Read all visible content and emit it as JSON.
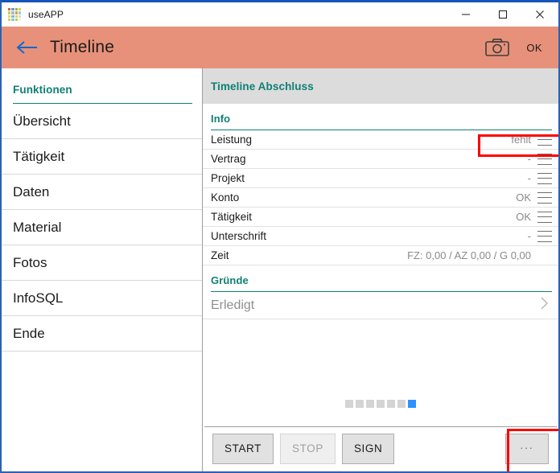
{
  "window": {
    "title": "useAPP",
    "icon": "app-grid-icon",
    "icon_colors": [
      "#e05b4a",
      "#63a0d8",
      "#7cc04a",
      "#d9d04a",
      "#c7d14f",
      "#b0b6c4",
      "#e2a13a",
      "#9ccbe8",
      "#e8d94f",
      "#7fb8e0",
      "#cfd86a",
      "#d7d7d7",
      "#e1c84e",
      "#8fc3e4",
      "#b7d04a",
      "#efefef"
    ],
    "controls": {
      "minimize": "minimize-icon",
      "maximize": "maximize-icon",
      "close": "close-icon"
    }
  },
  "appbar": {
    "back": "back-arrow-icon",
    "title": "Timeline",
    "camera": "camera-icon",
    "ok_label": "OK",
    "background": "#e8917a"
  },
  "sidebar": {
    "heading": "Funktionen",
    "items": [
      {
        "label": "Übersicht"
      },
      {
        "label": "Tätigkeit"
      },
      {
        "label": "Daten"
      },
      {
        "label": "Material"
      },
      {
        "label": "Fotos"
      },
      {
        "label": "InfoSQL"
      },
      {
        "label": "Ende"
      }
    ]
  },
  "main": {
    "panel_title": "Timeline Abschluss",
    "sections": [
      {
        "heading": "Info",
        "rows": [
          {
            "label": "Leistung",
            "value": "fehlt",
            "menu": true,
            "highlighted": true
          },
          {
            "label": "Vertrag",
            "value": "-",
            "menu": true,
            "highlighted": false
          },
          {
            "label": "Projekt",
            "value": "-",
            "menu": true,
            "highlighted": false
          },
          {
            "label": "Konto",
            "value": "OK",
            "menu": true,
            "highlighted": false
          },
          {
            "label": "Tätigkeit",
            "value": "OK",
            "menu": true,
            "highlighted": false
          },
          {
            "label": "Unterschrift",
            "value": "-",
            "menu": true,
            "highlighted": false
          },
          {
            "label": "Zeit",
            "value": "FZ: 0,00 / AZ 0,00 / G 0,00",
            "menu": false,
            "highlighted": false
          }
        ]
      },
      {
        "heading": "Gründe",
        "reason_row": {
          "label": "Erledigt",
          "chevron": "chevron-right-icon"
        }
      }
    ],
    "pager": {
      "total": 7,
      "active_index": 6
    }
  },
  "bottombar": {
    "buttons": [
      {
        "label": "START",
        "disabled": false
      },
      {
        "label": "STOP",
        "disabled": true
      },
      {
        "label": "SIGN",
        "disabled": false
      }
    ],
    "more_label": "...",
    "more_highlighted": true
  },
  "annotations": {
    "highlight_color": "#ff0000",
    "boxes": [
      "leistung-value-row",
      "more-button"
    ]
  },
  "theme": {
    "accent_teal": "#0f8074",
    "header_orange": "#e8917a",
    "panel_gray": "#dcdcdc",
    "active_dot_blue": "#2e90ff",
    "window_border_blue": "#2a61b5"
  }
}
